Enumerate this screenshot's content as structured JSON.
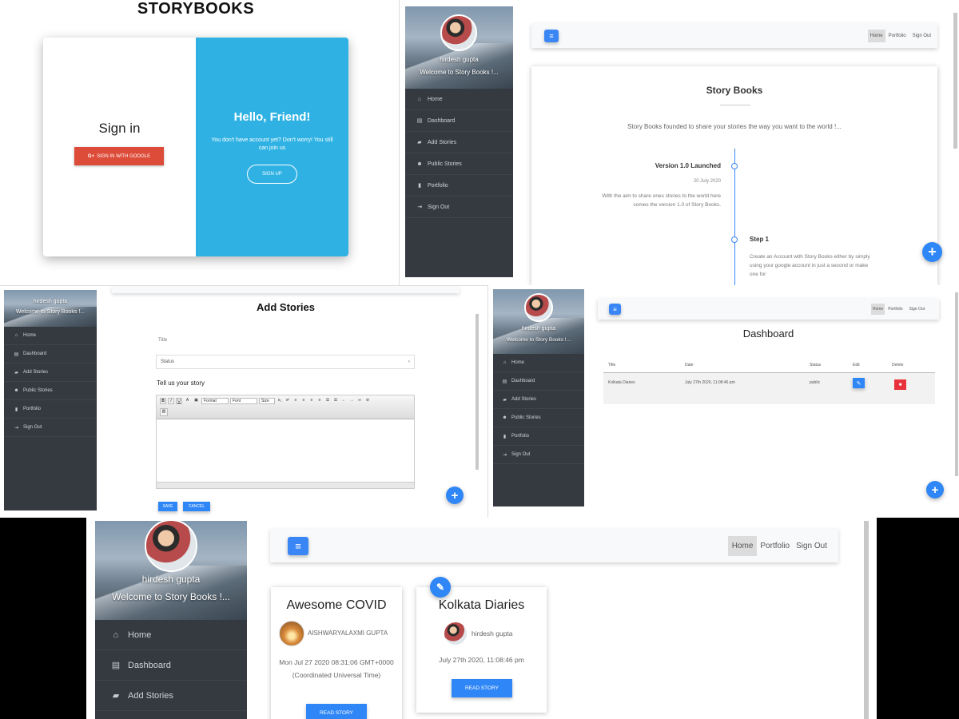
{
  "signin": {
    "brand": "STORYBOOKS",
    "heading": "Sign in",
    "google_btn": "SIGN IN WITH GOOGLE",
    "hello": "Hello, Friend!",
    "msg": "You don't have account yet? Don't worry! You still can join us",
    "signup_btn": "SIGN UP"
  },
  "profile": {
    "name": "hirdesh gupta",
    "welcome": "Welcome to Story Books !..."
  },
  "nav": {
    "home": "Home",
    "dashboard": "Dashboard",
    "add": "Add Stories",
    "public": "Public Stories",
    "portfolio": "Portfolio",
    "signout": "Sign Out"
  },
  "topnav": {
    "home": "Home",
    "portfolio": "Portfolio",
    "signout": "Sign Out"
  },
  "about": {
    "title": "Story Books",
    "tagline": "Story Books founded to share your stories the way you want to the world !...",
    "v1_title": "Version 1.0 Launched",
    "v1_date": "20 July 2020",
    "v1_text": "With the aim to share ones stories to the world here comes the version 1.0 of Story Books.",
    "s1_title": "Step 1",
    "s1_text": "Create an Account with Story Books either by simply using your google account in just a second or make one for"
  },
  "add_story": {
    "title": "Add Stories",
    "title_label": "Title",
    "status_value": "Status",
    "story_label": "Tell us your story",
    "format": "Format",
    "font": "Font",
    "size": "Size",
    "save": "SAVE",
    "cancel": "CANCEL"
  },
  "dashboard": {
    "title": "Dashboard",
    "columns": [
      "Title",
      "Date",
      "Status",
      "Edit",
      "Delete"
    ],
    "row": {
      "title": "Kolkata Diaries",
      "date": "July 27th 2020, 11:08:46 pm",
      "status": "public"
    }
  },
  "stories": [
    {
      "title": "Awesome COVID",
      "author": "AISHWARYALAXMI GUPTA",
      "date": "Mon Jul 27 2020 08:31:06 GMT+0000 (Coordinated Universal Time)",
      "btn": "READ STORY"
    },
    {
      "title": "Kolkata Diaries",
      "author": "hirdesh gupta",
      "date": "July 27th 2020, 11:08:46 pm",
      "btn": "READ STORY"
    }
  ],
  "colors": {
    "accent": "#2f86f6",
    "sidebar": "#343a40",
    "signin_panel": "#2fb2e3",
    "google": "#dd4b39",
    "delete": "#e8323c"
  },
  "icons": {
    "menu": "hamburger-icon",
    "fab": "plus-icon",
    "edit": "pencil-icon",
    "delete": "trash-icon"
  }
}
